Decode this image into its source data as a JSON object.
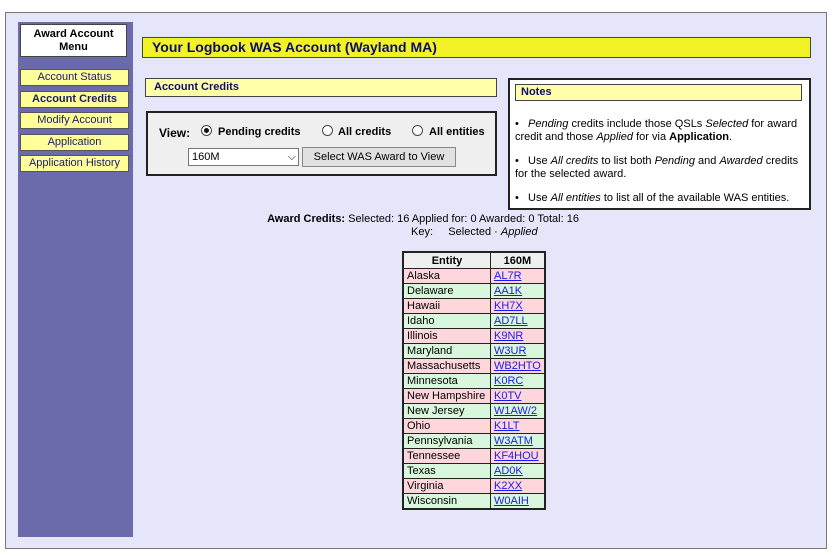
{
  "sidebar": {
    "header": "Award Account Menu",
    "items": [
      {
        "label": "Account Status",
        "active": false
      },
      {
        "label": "Account Credits",
        "active": true
      },
      {
        "label": "Modify Account",
        "active": false
      },
      {
        "label": "Application",
        "active": false
      },
      {
        "label": "Application History",
        "active": false
      }
    ]
  },
  "title": "Your Logbook WAS Account (Wayland MA)",
  "section_title": "Account Credits",
  "view": {
    "label": "View:",
    "options": [
      {
        "label": "Pending credits",
        "checked": true
      },
      {
        "label": "All credits",
        "checked": false
      },
      {
        "label": "All entities",
        "checked": false
      }
    ],
    "selected_band": "160M",
    "button_label": "Select WAS Award to View"
  },
  "notes": {
    "title": "Notes"
  },
  "summary": {
    "label": "Award Credits:",
    "text": "Selected: 16 Applied for: 0 Awarded: 0 Total: 16",
    "key_label": "Key:",
    "key_selected": "Selected",
    "key_sep": "·",
    "key_applied": "Applied"
  },
  "table": {
    "headers": [
      "Entity",
      "160M"
    ],
    "rows": [
      {
        "entity": "Alaska",
        "call": "AL7R",
        "status": "pink"
      },
      {
        "entity": "Delaware",
        "call": "AA1K",
        "status": "green"
      },
      {
        "entity": "Hawaii",
        "call": "KH7X",
        "status": "pink"
      },
      {
        "entity": "Idaho",
        "call": "AD7LL",
        "status": "green"
      },
      {
        "entity": "Illinois",
        "call": "K9NR",
        "status": "pink"
      },
      {
        "entity": "Maryland",
        "call": "W3UR",
        "status": "green"
      },
      {
        "entity": "Massachusetts",
        "call": "WB2HTO",
        "status": "pink"
      },
      {
        "entity": "Minnesota",
        "call": "K0RC",
        "status": "green"
      },
      {
        "entity": "New Hampshire",
        "call": "K0TV",
        "status": "pink"
      },
      {
        "entity": "New Jersey",
        "call": "W1AW/2",
        "status": "green"
      },
      {
        "entity": "Ohio",
        "call": "K1LT",
        "status": "pink"
      },
      {
        "entity": "Pennsylvania",
        "call": "W3ATM",
        "status": "green"
      },
      {
        "entity": "Tennessee",
        "call": "KF4HOU",
        "status": "pink"
      },
      {
        "entity": "Texas",
        "call": "AD0K",
        "status": "green"
      },
      {
        "entity": "Virginia",
        "call": "K2XX",
        "status": "pink"
      },
      {
        "entity": "Wisconsin",
        "call": "W0AIH",
        "status": "green"
      }
    ]
  }
}
